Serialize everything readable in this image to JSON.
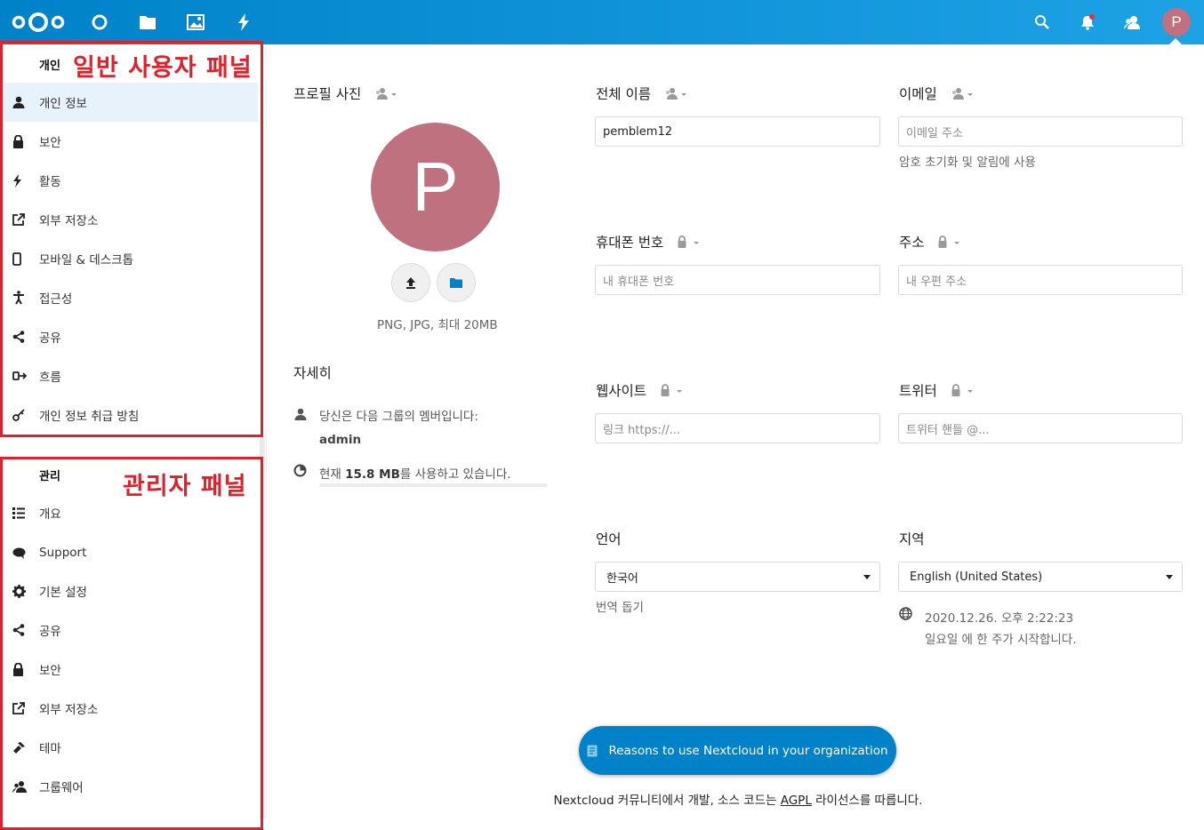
{
  "header": {
    "avatar_letter": "P",
    "colors": {
      "brand": "#0082c9",
      "avatar": "#c0717f"
    },
    "apps": [
      "dashboard-icon",
      "files-icon",
      "photos-icon",
      "activity-icon"
    ],
    "right_icons": [
      "search-icon",
      "notifications-icon",
      "contacts-icon"
    ]
  },
  "annotations": {
    "user_panel": "일반 사용자 패널",
    "admin_panel": "관리자 패널"
  },
  "sidebar": {
    "personal_title": "개인",
    "personal_items": [
      {
        "label": "개인 정보",
        "icon": "user-icon"
      },
      {
        "label": "보안",
        "icon": "lock-icon"
      },
      {
        "label": "활동",
        "icon": "activity-icon"
      },
      {
        "label": "외부 저장소",
        "icon": "external-icon"
      },
      {
        "label": "모바일 & 데스크톱",
        "icon": "phone-icon"
      },
      {
        "label": "접근성",
        "icon": "accessibility-icon"
      },
      {
        "label": "공유",
        "icon": "share-icon"
      },
      {
        "label": "흐름",
        "icon": "flow-icon"
      },
      {
        "label": "개인 정보 취급 방침",
        "icon": "key-icon"
      }
    ],
    "admin_title": "관리",
    "admin_items": [
      {
        "label": "개요",
        "icon": "list-icon"
      },
      {
        "label": "Support",
        "icon": "comment-icon"
      },
      {
        "label": "기본 설정",
        "icon": "gear-icon"
      },
      {
        "label": "공유",
        "icon": "share-icon"
      },
      {
        "label": "보안",
        "icon": "lock-icon"
      },
      {
        "label": "외부 저장소",
        "icon": "external-icon"
      },
      {
        "label": "테마",
        "icon": "theming-icon"
      },
      {
        "label": "그룹웨어",
        "icon": "groupware-icon"
      }
    ]
  },
  "profile": {
    "title": "프로필 사진",
    "avatar_letter": "P",
    "file_hint": "PNG, JPG, 최대 20MB"
  },
  "details": {
    "title": "자세히",
    "groups_text": "당신은 다음 그룹의 멤버입니다:",
    "group": "admin",
    "usage_prefix": "현재 ",
    "usage_value": "15.8 MB",
    "usage_suffix": "를 사용하고 있습니다."
  },
  "fields": {
    "fullname": {
      "label": "전체 이름",
      "value": "pemblem12"
    },
    "email": {
      "label": "이메일",
      "placeholder": "이메일 주소",
      "hint": "암호 초기화 및 알림에 사용"
    },
    "phone": {
      "label": "휴대폰 번호",
      "placeholder": "내 휴대폰 번호"
    },
    "address": {
      "label": "주소",
      "placeholder": "내 우편 주소"
    },
    "website": {
      "label": "웹사이트",
      "placeholder": "링크 https://..."
    },
    "twitter": {
      "label": "트위터",
      "placeholder": "트위터 핸들 @..."
    },
    "language": {
      "label": "언어",
      "value": "한국어",
      "hint": "번역 돕기"
    },
    "locale": {
      "label": "지역",
      "value": "English (United States)",
      "datetime": "2020.12.26. 오후 2:22:23",
      "week_start": "일요일 에 한 주가 시작합니다."
    }
  },
  "cta": "Reasons to use Nextcloud in your organization",
  "footer": {
    "prefix": "Nextcloud 커뮤니티에서 개발, 소스 코드는 ",
    "link": "AGPL",
    "suffix": " 라이선스를 따릅니다."
  }
}
